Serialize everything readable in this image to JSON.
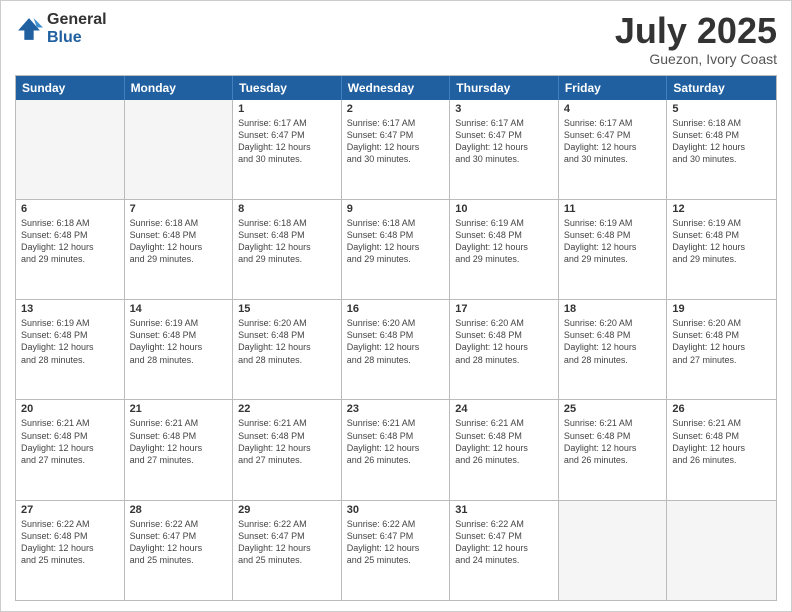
{
  "logo": {
    "general": "General",
    "blue": "Blue"
  },
  "title": {
    "month": "July 2025",
    "location": "Guezon, Ivory Coast"
  },
  "calendar": {
    "headers": [
      "Sunday",
      "Monday",
      "Tuesday",
      "Wednesday",
      "Thursday",
      "Friday",
      "Saturday"
    ],
    "weeks": [
      [
        {
          "day": "",
          "info": ""
        },
        {
          "day": "",
          "info": ""
        },
        {
          "day": "1",
          "info": "Sunrise: 6:17 AM\nSunset: 6:47 PM\nDaylight: 12 hours\nand 30 minutes."
        },
        {
          "day": "2",
          "info": "Sunrise: 6:17 AM\nSunset: 6:47 PM\nDaylight: 12 hours\nand 30 minutes."
        },
        {
          "day": "3",
          "info": "Sunrise: 6:17 AM\nSunset: 6:47 PM\nDaylight: 12 hours\nand 30 minutes."
        },
        {
          "day": "4",
          "info": "Sunrise: 6:17 AM\nSunset: 6:47 PM\nDaylight: 12 hours\nand 30 minutes."
        },
        {
          "day": "5",
          "info": "Sunrise: 6:18 AM\nSunset: 6:48 PM\nDaylight: 12 hours\nand 30 minutes."
        }
      ],
      [
        {
          "day": "6",
          "info": "Sunrise: 6:18 AM\nSunset: 6:48 PM\nDaylight: 12 hours\nand 29 minutes."
        },
        {
          "day": "7",
          "info": "Sunrise: 6:18 AM\nSunset: 6:48 PM\nDaylight: 12 hours\nand 29 minutes."
        },
        {
          "day": "8",
          "info": "Sunrise: 6:18 AM\nSunset: 6:48 PM\nDaylight: 12 hours\nand 29 minutes."
        },
        {
          "day": "9",
          "info": "Sunrise: 6:18 AM\nSunset: 6:48 PM\nDaylight: 12 hours\nand 29 minutes."
        },
        {
          "day": "10",
          "info": "Sunrise: 6:19 AM\nSunset: 6:48 PM\nDaylight: 12 hours\nand 29 minutes."
        },
        {
          "day": "11",
          "info": "Sunrise: 6:19 AM\nSunset: 6:48 PM\nDaylight: 12 hours\nand 29 minutes."
        },
        {
          "day": "12",
          "info": "Sunrise: 6:19 AM\nSunset: 6:48 PM\nDaylight: 12 hours\nand 29 minutes."
        }
      ],
      [
        {
          "day": "13",
          "info": "Sunrise: 6:19 AM\nSunset: 6:48 PM\nDaylight: 12 hours\nand 28 minutes."
        },
        {
          "day": "14",
          "info": "Sunrise: 6:19 AM\nSunset: 6:48 PM\nDaylight: 12 hours\nand 28 minutes."
        },
        {
          "day": "15",
          "info": "Sunrise: 6:20 AM\nSunset: 6:48 PM\nDaylight: 12 hours\nand 28 minutes."
        },
        {
          "day": "16",
          "info": "Sunrise: 6:20 AM\nSunset: 6:48 PM\nDaylight: 12 hours\nand 28 minutes."
        },
        {
          "day": "17",
          "info": "Sunrise: 6:20 AM\nSunset: 6:48 PM\nDaylight: 12 hours\nand 28 minutes."
        },
        {
          "day": "18",
          "info": "Sunrise: 6:20 AM\nSunset: 6:48 PM\nDaylight: 12 hours\nand 28 minutes."
        },
        {
          "day": "19",
          "info": "Sunrise: 6:20 AM\nSunset: 6:48 PM\nDaylight: 12 hours\nand 27 minutes."
        }
      ],
      [
        {
          "day": "20",
          "info": "Sunrise: 6:21 AM\nSunset: 6:48 PM\nDaylight: 12 hours\nand 27 minutes."
        },
        {
          "day": "21",
          "info": "Sunrise: 6:21 AM\nSunset: 6:48 PM\nDaylight: 12 hours\nand 27 minutes."
        },
        {
          "day": "22",
          "info": "Sunrise: 6:21 AM\nSunset: 6:48 PM\nDaylight: 12 hours\nand 27 minutes."
        },
        {
          "day": "23",
          "info": "Sunrise: 6:21 AM\nSunset: 6:48 PM\nDaylight: 12 hours\nand 26 minutes."
        },
        {
          "day": "24",
          "info": "Sunrise: 6:21 AM\nSunset: 6:48 PM\nDaylight: 12 hours\nand 26 minutes."
        },
        {
          "day": "25",
          "info": "Sunrise: 6:21 AM\nSunset: 6:48 PM\nDaylight: 12 hours\nand 26 minutes."
        },
        {
          "day": "26",
          "info": "Sunrise: 6:21 AM\nSunset: 6:48 PM\nDaylight: 12 hours\nand 26 minutes."
        }
      ],
      [
        {
          "day": "27",
          "info": "Sunrise: 6:22 AM\nSunset: 6:48 PM\nDaylight: 12 hours\nand 25 minutes."
        },
        {
          "day": "28",
          "info": "Sunrise: 6:22 AM\nSunset: 6:47 PM\nDaylight: 12 hours\nand 25 minutes."
        },
        {
          "day": "29",
          "info": "Sunrise: 6:22 AM\nSunset: 6:47 PM\nDaylight: 12 hours\nand 25 minutes."
        },
        {
          "day": "30",
          "info": "Sunrise: 6:22 AM\nSunset: 6:47 PM\nDaylight: 12 hours\nand 25 minutes."
        },
        {
          "day": "31",
          "info": "Sunrise: 6:22 AM\nSunset: 6:47 PM\nDaylight: 12 hours\nand 24 minutes."
        },
        {
          "day": "",
          "info": ""
        },
        {
          "day": "",
          "info": ""
        }
      ]
    ]
  }
}
